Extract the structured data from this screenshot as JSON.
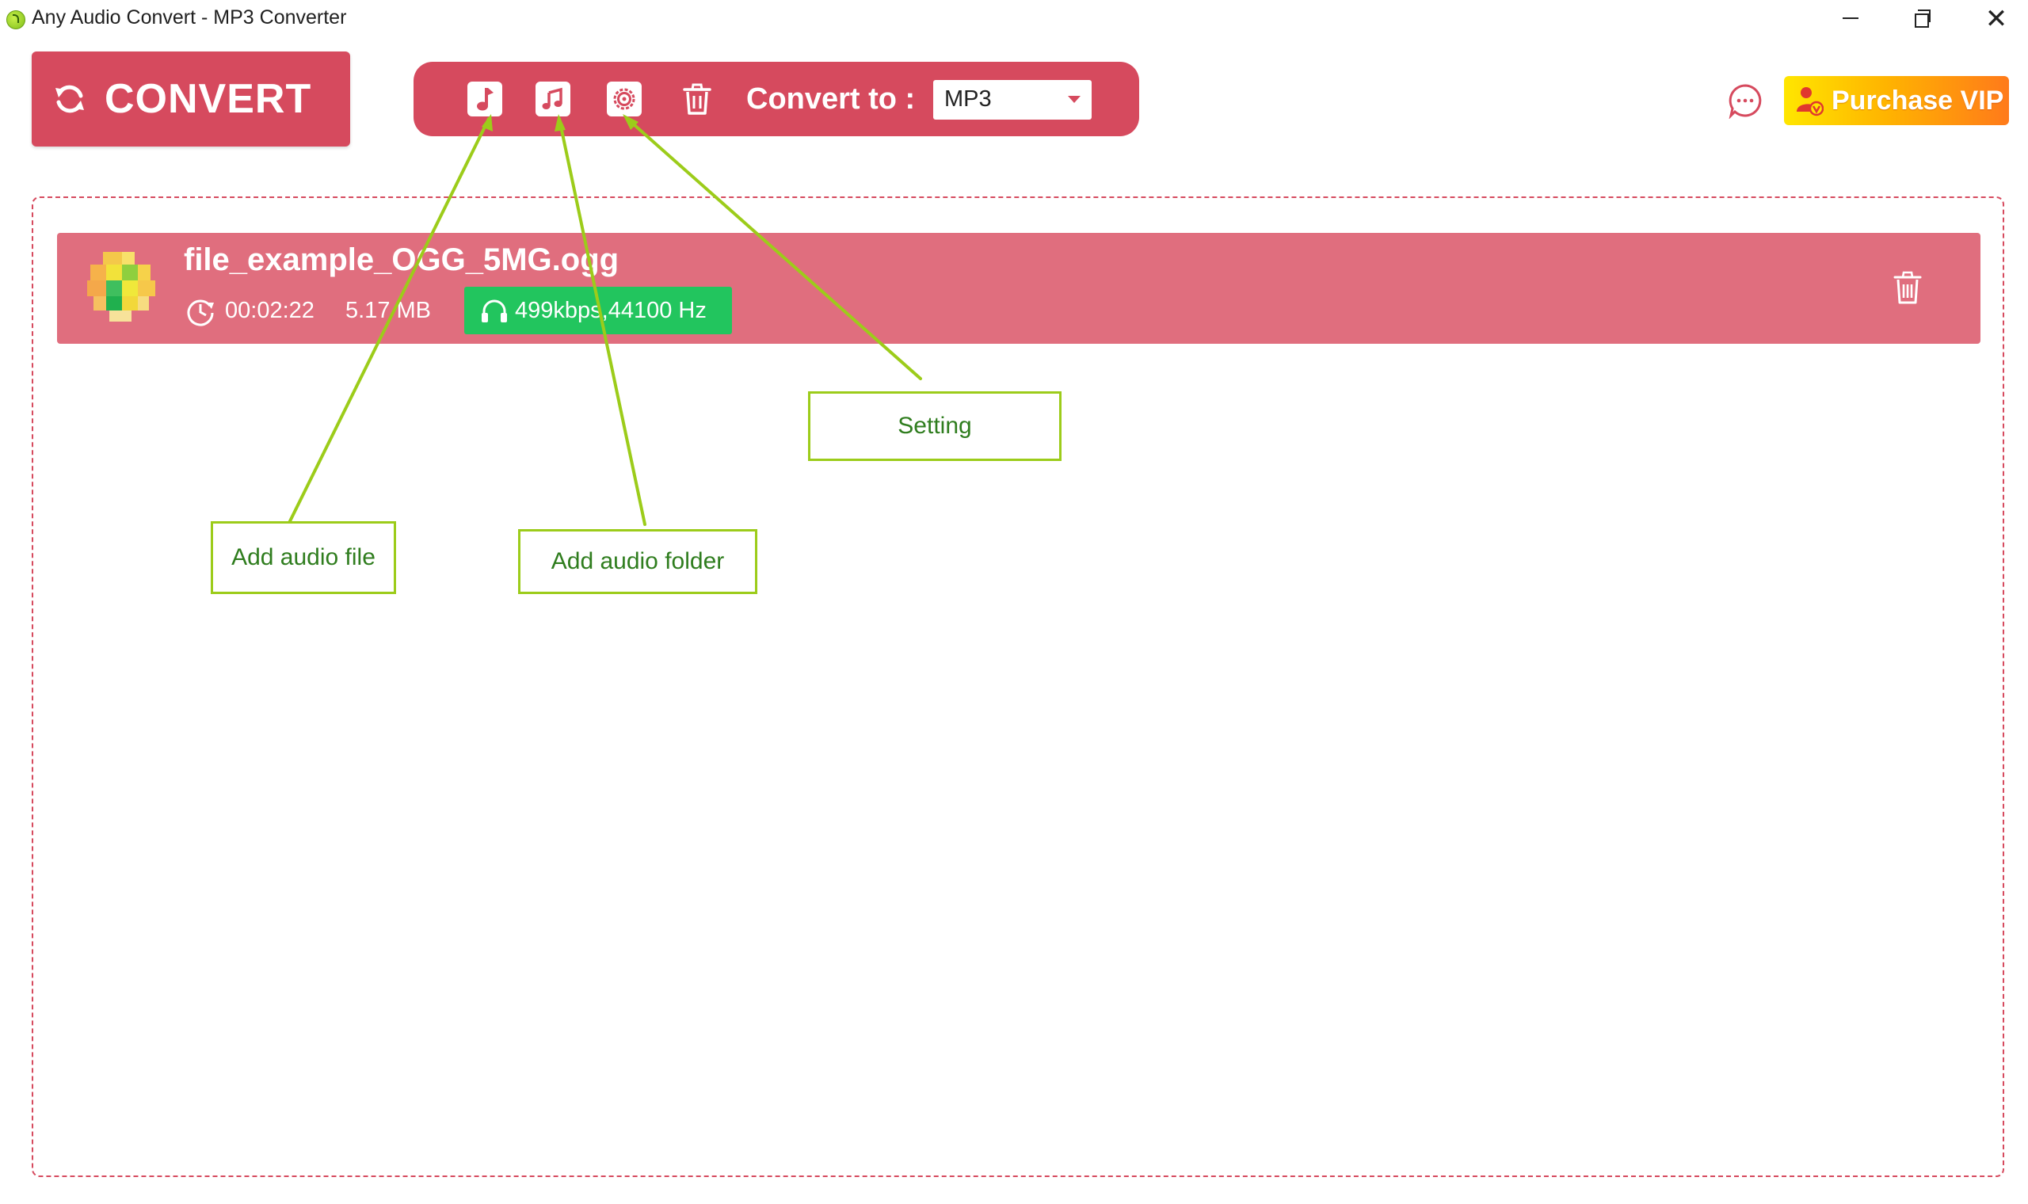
{
  "window": {
    "title": "Any Audio Convert - MP3 Converter",
    "controls": {
      "minimize": "minimize",
      "maximize": "restore",
      "close": "✕"
    }
  },
  "toolbar": {
    "convert_label": "CONVERT",
    "convert_to_label": "Convert to :",
    "format_value": "MP3",
    "icons": [
      "add-audio-file-icon",
      "add-audio-folder-icon",
      "setting-icon",
      "trash-icon"
    ],
    "vip_label": "Purchase VIP"
  },
  "file": {
    "name": "file_example_OGG_5MG.ogg",
    "duration": "00:02:22",
    "size": "5.17 MB",
    "audio_info": "499kbps,44100 Hz"
  },
  "annotations": {
    "add_file": "Add audio file",
    "add_folder": "Add audio folder",
    "setting": "Setting"
  },
  "colors": {
    "accent": "#d64a5e",
    "file_row": "#e06e7e",
    "badge": "#22c55e",
    "annotation": "#9ccc1a",
    "annotation_text": "#2f7d1e"
  }
}
